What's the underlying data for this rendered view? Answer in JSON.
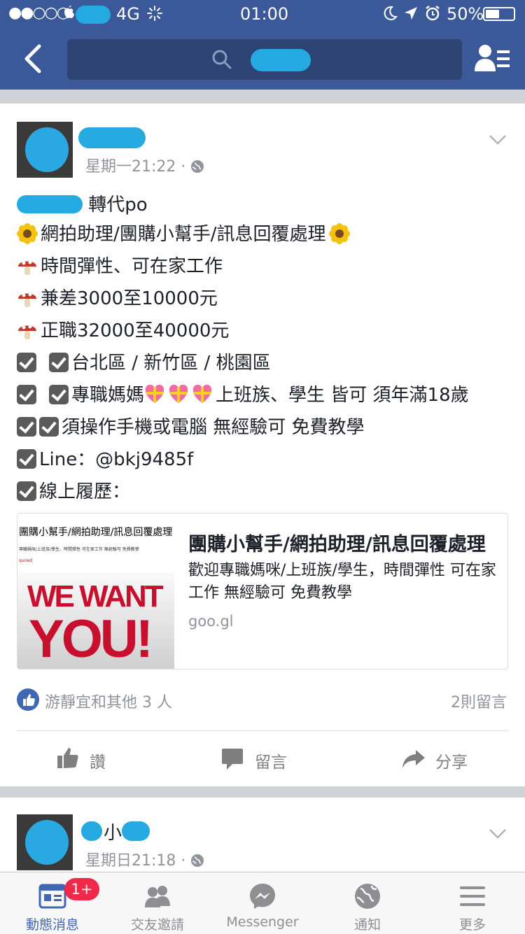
{
  "status_bar": {
    "carrier_dots": "●●○○○",
    "network": "4G",
    "time": "01:00",
    "battery": "50%",
    "battery_level": 0.5
  },
  "nav": {
    "back_icon": "chevron-left-icon",
    "search_icon": "search-icon",
    "friends_icon": "friends-list-icon"
  },
  "post1": {
    "timestamp": "星期一21:22",
    "separator": "·",
    "repost_label": "轉代po",
    "lines": [
      "網拍助理/團購小幫手/訊息回覆處理",
      "時間彈性、可在家工作",
      "兼差3000至10000元",
      "正職32000至40000元",
      "台北區 / 新竹區 / 桃園區",
      "專職媽媽",
      "上班族、學生 皆可 須年滿18歲",
      "須操作手機或電腦 無經驗可 免費教學",
      "Line：@bkj9485f",
      "線上履歷："
    ],
    "link": {
      "thumb_heading": "團購小幫手/網拍助理/訊息回覆處理",
      "thumb_sub": "專職媽咪/上班族/學生、時間彈性 可在家工作 無經驗可 免費教學",
      "thumb_red": "quired",
      "thumb_big1": "WE WANT",
      "thumb_big2": "YOU!",
      "title": "團購小幫手/網拍助理/訊息回覆處理",
      "description": "歡迎專職媽咪/上班族/學生，時間彈性 可在家工作 無經驗可 免費教學",
      "domain": "goo.gl"
    },
    "likes_text": "游靜宜和其他 3 人",
    "comments_count": "2則留言",
    "actions": {
      "like": "讚",
      "comment": "留言",
      "share": "分享"
    }
  },
  "post2": {
    "name_visible": "小",
    "timestamp": "星期日21:18",
    "separator": "·"
  },
  "tabbar": {
    "items": [
      {
        "label": "動態消息",
        "icon": "news-feed-icon"
      },
      {
        "label": "交友邀請",
        "icon": "friend-requests-icon"
      },
      {
        "label": "Messenger",
        "icon": "messenger-icon"
      },
      {
        "label": "通知",
        "icon": "globe-notifications-icon"
      },
      {
        "label": "更多",
        "icon": "menu-icon"
      }
    ],
    "badge": "1+"
  },
  "colors": {
    "brand": "#3b5998",
    "redaction": "#24a9e0",
    "badge": "#f02849"
  }
}
